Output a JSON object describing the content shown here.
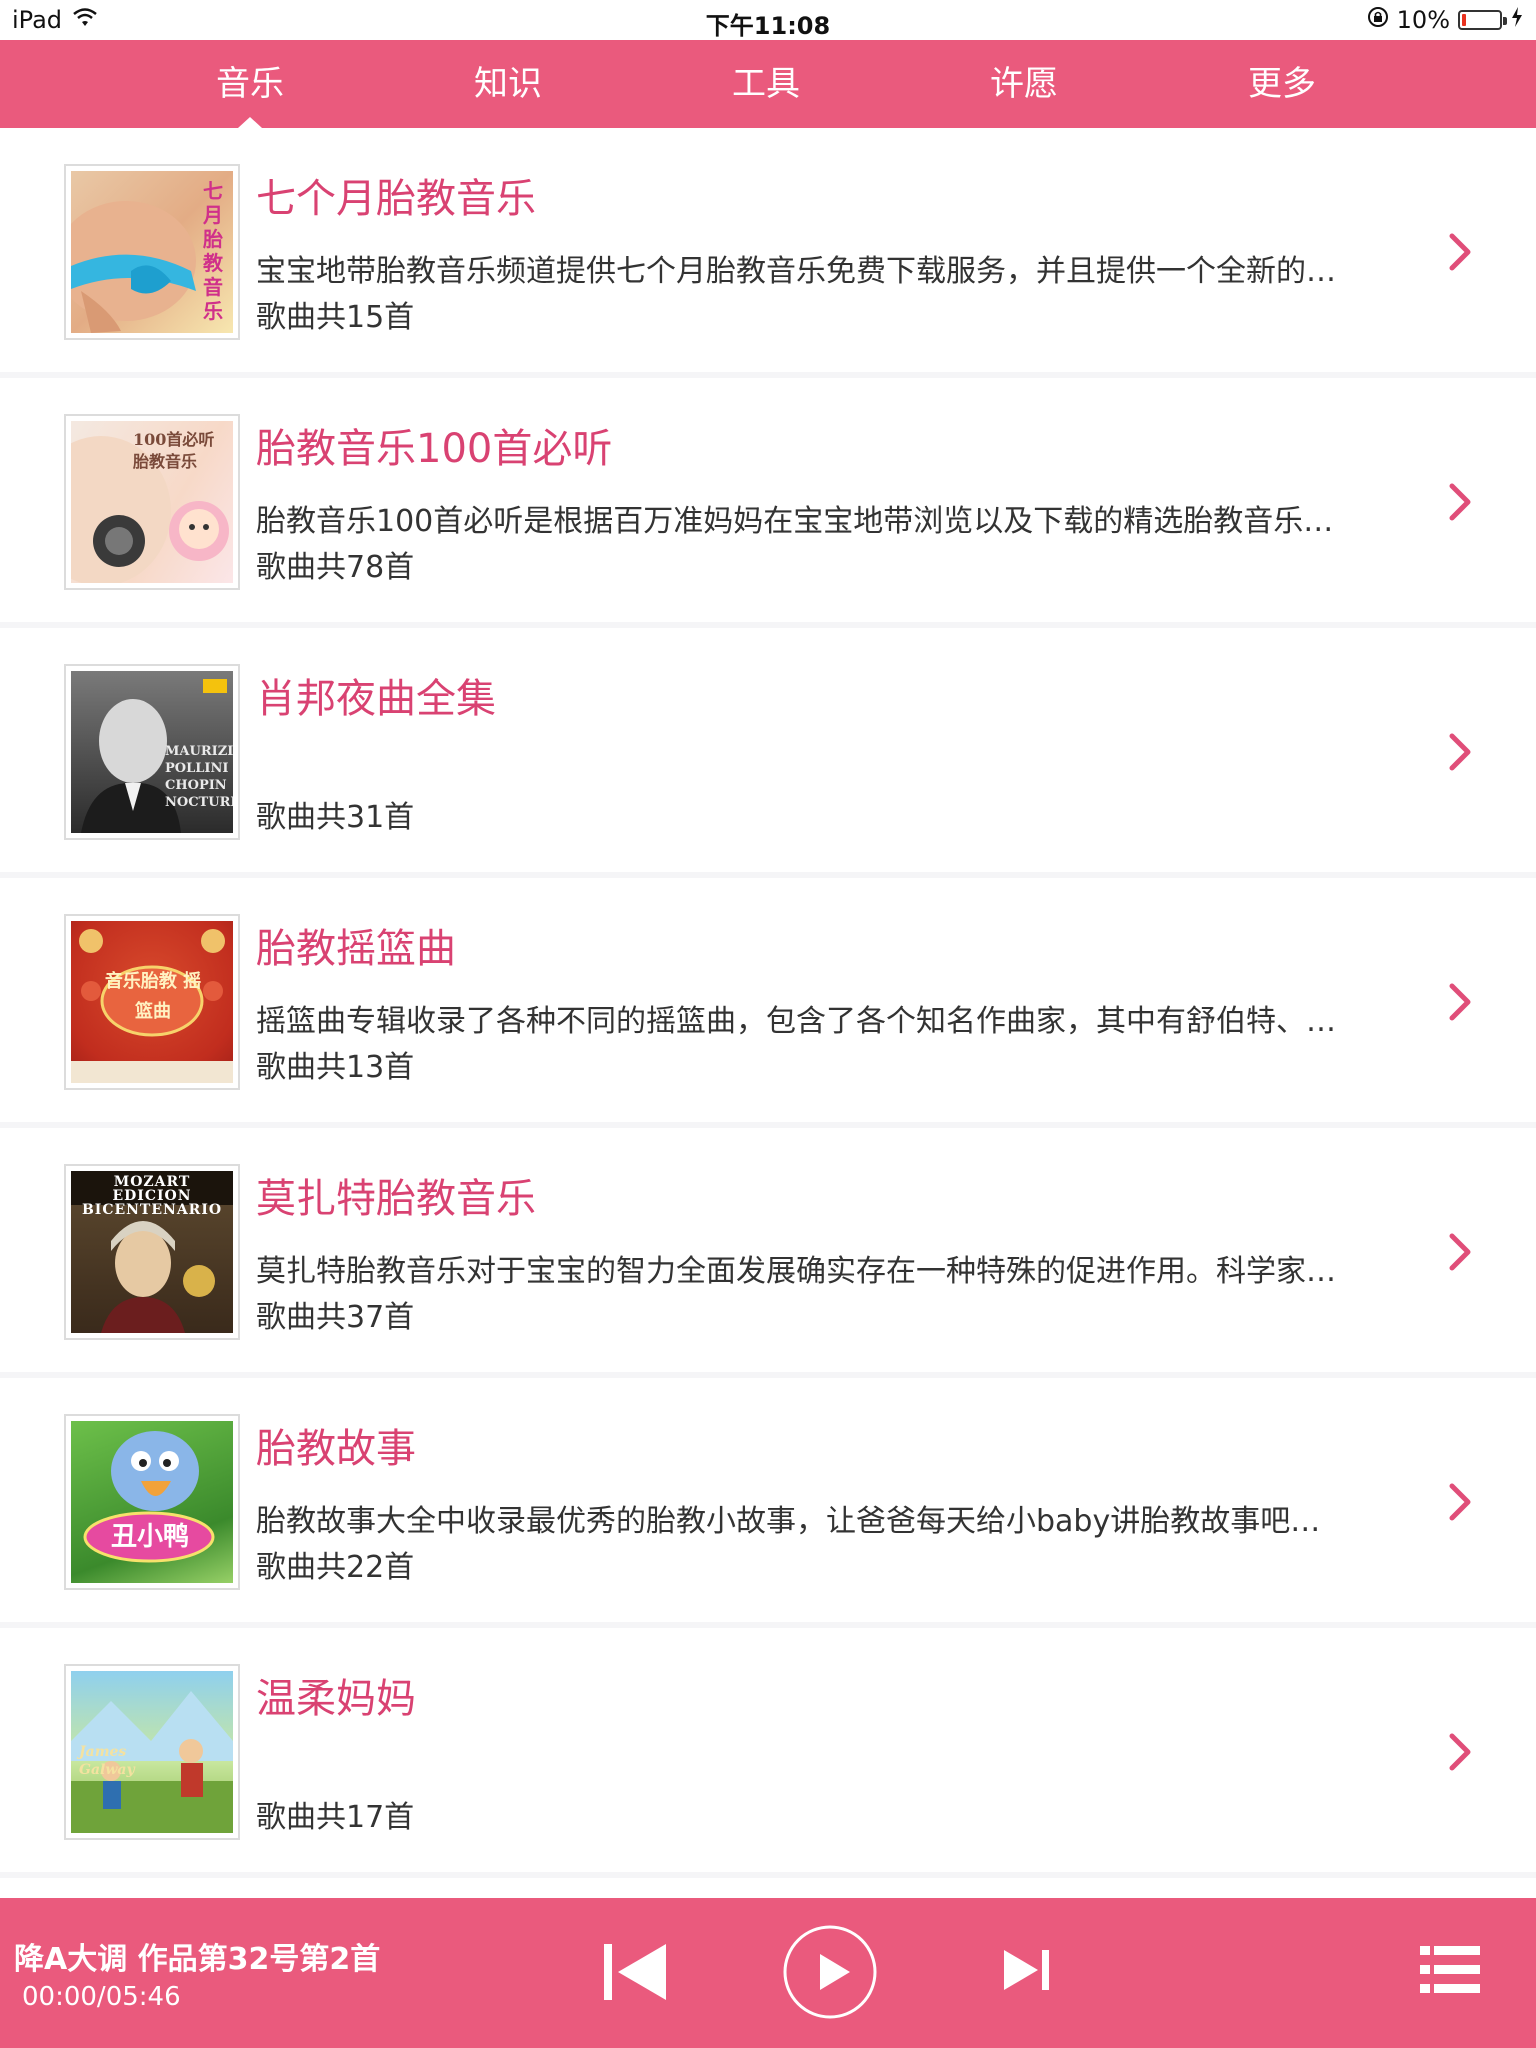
{
  "status_bar": {
    "device": "iPad",
    "time": "下午11:08",
    "battery_text": "10%",
    "battery_level": 0.1,
    "icons": [
      "wifi-icon",
      "rotation-lock-icon",
      "battery-icon",
      "charging-icon"
    ]
  },
  "tabs": [
    {
      "label": "音乐",
      "selected": true
    },
    {
      "label": "知识",
      "selected": false
    },
    {
      "label": "工具",
      "selected": false
    },
    {
      "label": "许愿",
      "selected": false
    },
    {
      "label": "更多",
      "selected": false
    }
  ],
  "albums": [
    {
      "title": "七个月胎教音乐",
      "description": "宝宝地带胎教音乐频道提供七个月胎教音乐免费下载服务，并且提供一个全新的…",
      "count": "歌曲共15首",
      "cover_text": "七月胎教音乐"
    },
    {
      "title": "胎教音乐100首必听",
      "description": "胎教音乐100首必听是根据百万准妈妈在宝宝地带浏览以及下载的精选胎教音乐…",
      "count": "歌曲共78首",
      "cover_text": "100首必听 胎教音乐"
    },
    {
      "title": "肖邦夜曲全集",
      "description": "",
      "count": "歌曲共31首",
      "cover_text": "MAURIZIO POLLINI CHOPIN NOCTURNES"
    },
    {
      "title": "胎教摇篮曲",
      "description": "摇篮曲专辑收录了各种不同的摇篮曲，包含了各个知名作曲家，其中有舒伯特、…",
      "count": "歌曲共13首",
      "cover_text": "音乐胎教 摇篮曲"
    },
    {
      "title": "莫扎特胎教音乐",
      "description": "莫扎特胎教音乐对于宝宝的智力全面发展确实存在一种特殊的促进作用。科学家…",
      "count": "歌曲共37首",
      "cover_text": "MOZART EDICION BICENTENARIO"
    },
    {
      "title": "胎教故事",
      "description": "胎教故事大全中收录最优秀的胎教小故事，让爸爸每天给小baby讲胎教故事吧…",
      "count": "歌曲共22首",
      "cover_text": "丑小鸭"
    },
    {
      "title": "温柔妈妈",
      "description": "",
      "count": "歌曲共17首",
      "cover_text": "James Galway"
    }
  ],
  "player": {
    "title": "降A大调 作品第32号第2首",
    "time": "00:00/05:46",
    "icons": [
      "previous-icon",
      "play-icon",
      "next-icon",
      "playlist-icon"
    ]
  },
  "colors": {
    "accent": "#ea5a7d",
    "title_text": "#d94272",
    "body_text": "#333333",
    "divider": "#f5f5f7"
  }
}
